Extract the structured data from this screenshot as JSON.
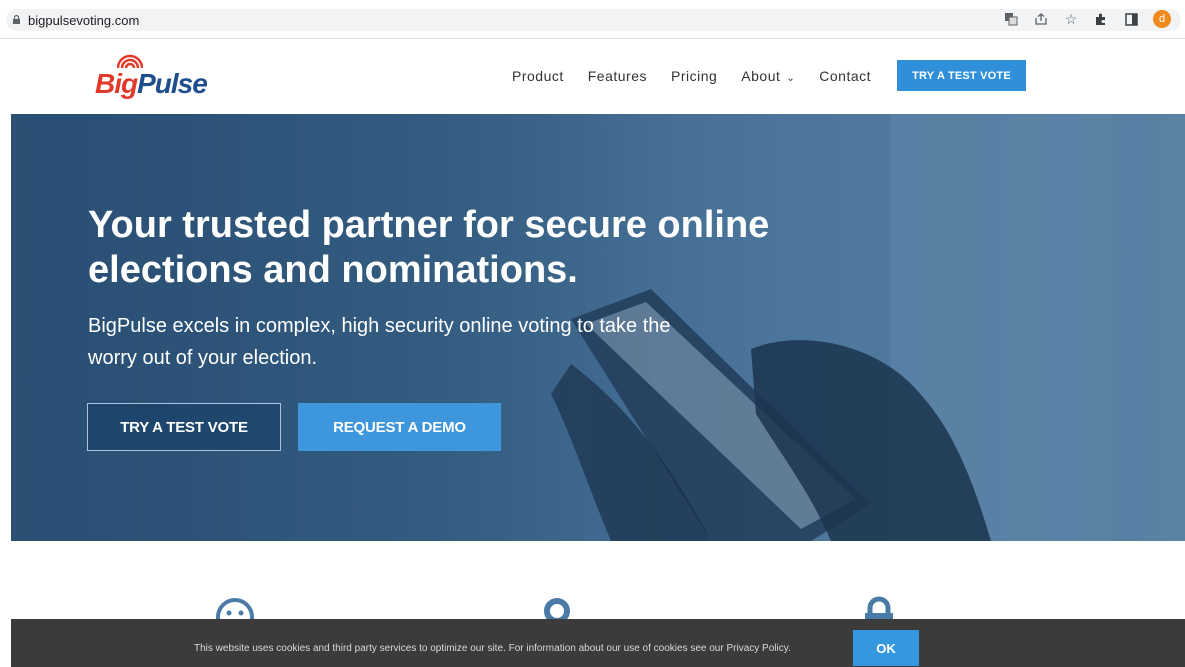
{
  "browser": {
    "url": "bigpulsevoting.com",
    "profile_initial": "d",
    "icons": [
      "translate-icon",
      "share-icon",
      "star-icon",
      "extensions-icon",
      "sidepanel-icon"
    ]
  },
  "header": {
    "logo_big": "Big",
    "logo_pulse": "Pulse",
    "nav": [
      {
        "label": "Product"
      },
      {
        "label": "Features"
      },
      {
        "label": "Pricing"
      },
      {
        "label": "About"
      },
      {
        "label": "Contact"
      }
    ],
    "cta_label": "TRY A TEST VOTE"
  },
  "hero": {
    "title": "Your trusted partner for secure online elections and nominations.",
    "subtitle": "BigPulse excels in complex, high security online voting to take the worry out of your election.",
    "try_label": "TRY A TEST VOTE",
    "demo_label": "REQUEST A DEMO"
  },
  "cookie": {
    "text": "This website uses cookies and third party services to optimize our site. For information about our use of cookies see our Privacy Policy.",
    "ok_label": "OK"
  },
  "colors": {
    "brand_red": "#e03a2a",
    "brand_blue": "#1f4e8c",
    "accent": "#2f8fd8",
    "hero_bg": "#3a6489",
    "cookie_bg": "#3b3b3b"
  }
}
